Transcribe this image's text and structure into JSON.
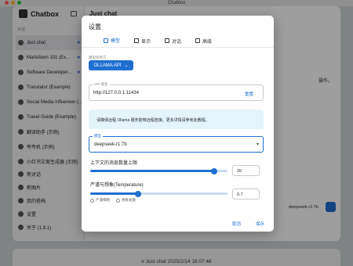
{
  "os": {
    "title": "Chatbox"
  },
  "sidebar": {
    "app_name": "Chatbox",
    "section_label": "对话",
    "items": [
      {
        "label": "Just chat",
        "starred": true,
        "active": true,
        "icon": "chat-icon"
      },
      {
        "label": "Markdown 101 (Ex...",
        "starred": true,
        "icon": "chat-icon"
      },
      {
        "label": "Software Developer...",
        "starred": true,
        "icon": "avatar-icon"
      },
      {
        "label": "Translator (Example)",
        "starred": false,
        "icon": "chat-icon"
      },
      {
        "label": "Social Media Influencer (...",
        "starred": true,
        "icon": "avatar-icon"
      },
      {
        "label": "Travel Guide (Example)",
        "starred": false,
        "icon": "avatar-icon"
      },
      {
        "label": "翻译助手 (示例)",
        "starred": false,
        "icon": "avatar-icon"
      },
      {
        "label": "夸夸机 (示例)",
        "starred": false,
        "icon": "chat-icon"
      },
      {
        "label": "小红书文案生成器 (示例)",
        "starred": false,
        "icon": "avatar-icon"
      }
    ],
    "bottom": [
      {
        "label": "新对话",
        "icon": "plus-icon"
      },
      {
        "label": "新图片",
        "icon": "image-icon"
      },
      {
        "label": "我的搭档",
        "icon": "robot-icon"
      },
      {
        "label": "设置",
        "icon": "gear-icon"
      },
      {
        "label": "关于 (1.9.1)",
        "icon": "info-icon"
      }
    ]
  },
  "main": {
    "title": "Just chat",
    "partial_text": "操作。",
    "model_chip": "deepseek-r1:7b"
  },
  "bottom_card": {
    "text": "# Just chat 2025/2/14 18:07:48"
  },
  "modal": {
    "title": "设置",
    "tabs": [
      {
        "label": "模型",
        "active": true,
        "icon": "cube-icon"
      },
      {
        "label": "显示",
        "active": false,
        "icon": "display-icon"
      },
      {
        "label": "对话",
        "active": false,
        "icon": "chat-icon"
      },
      {
        "label": "高级",
        "active": false,
        "icon": "gear-icon"
      }
    ],
    "provider_label": "模型提供方",
    "provider_value": "OLLAMA API",
    "api_label": "API 域名",
    "api_value": "http://127.0.0.1:11434",
    "reset_label": "重置",
    "info_text": "请确保远程 Ollama 服务能够远程连接。更多详情请参考此教程。",
    "model_label": "模型",
    "model_value": "deepseek-r1:7b",
    "context_title": "上下文的消息数量上限",
    "context_value": "20",
    "context_fraction": 0.9,
    "temp_title": "严谨与想象(Temperature)",
    "temp_value": "0.7",
    "temp_fraction": 0.35,
    "chip_left": "严谨细致",
    "chip_right": "想象发散",
    "cancel_label": "取消",
    "save_label": "保存",
    "accent_color": "#1f6fd1"
  }
}
